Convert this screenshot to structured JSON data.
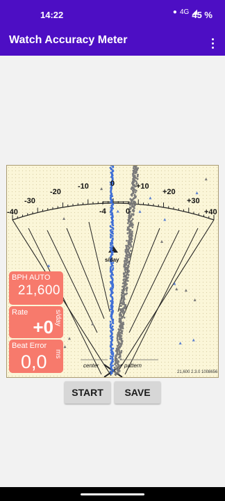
{
  "status_bar": {
    "time": "14:22",
    "battery": "45 %",
    "network": "4G"
  },
  "app_bar": {
    "title": "Watch Accuracy Meter",
    "menu_icon": "more-vert-icon"
  },
  "meter": {
    "scale_labels": [
      "-40",
      "-30",
      "-20",
      "-10",
      "0",
      "+10",
      "+20",
      "+30",
      "+40"
    ],
    "inner_labels": [
      "-4",
      "0"
    ],
    "unit_label": "s/day",
    "center_label": "center",
    "pattern_label": "pattern",
    "version_text": "21,600 2.3.0 1008656"
  },
  "bph": {
    "label": "BPH AUTO",
    "value": "21,600"
  },
  "rate": {
    "label": "Rate",
    "value": "+0",
    "unit": "s/day"
  },
  "beat_error": {
    "label": "Beat Error",
    "value": "0,0",
    "unit": "ms"
  },
  "buttons": {
    "start": "START",
    "save": "SAVE"
  },
  "colors": {
    "app_bar": "#4d0ec4",
    "box": "#f77a6c",
    "trace_blue": "#3f6fd6",
    "trace_gray": "#7a7a7a",
    "meter_bg": "#fbf6d8"
  }
}
